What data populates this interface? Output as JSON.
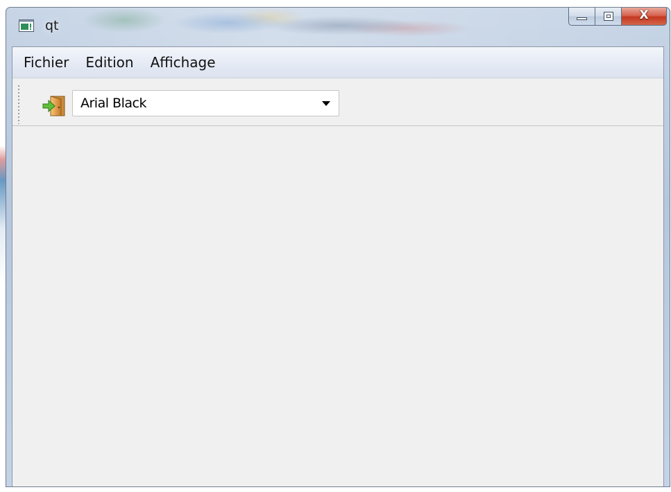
{
  "window": {
    "title": "qt",
    "app_icon": "qt-window-icon",
    "caption_buttons": {
      "minimize_icon": "minimize-icon",
      "maximize_icon": "maximize-icon",
      "close_icon": "close-icon",
      "close_glyph": "X",
      "close_color": "#c7432a"
    }
  },
  "menubar": {
    "items": [
      {
        "label": "Fichier"
      },
      {
        "label": "Edition"
      },
      {
        "label": "Affichage"
      }
    ]
  },
  "toolbar": {
    "exit_icon": "exit-door-icon",
    "font_combo": {
      "value": "Arial Black",
      "arrow_icon": "dropdown-arrow-icon"
    }
  },
  "colors": {
    "client_bg": "#f0f0f0",
    "frame": "#b5c7dd"
  }
}
